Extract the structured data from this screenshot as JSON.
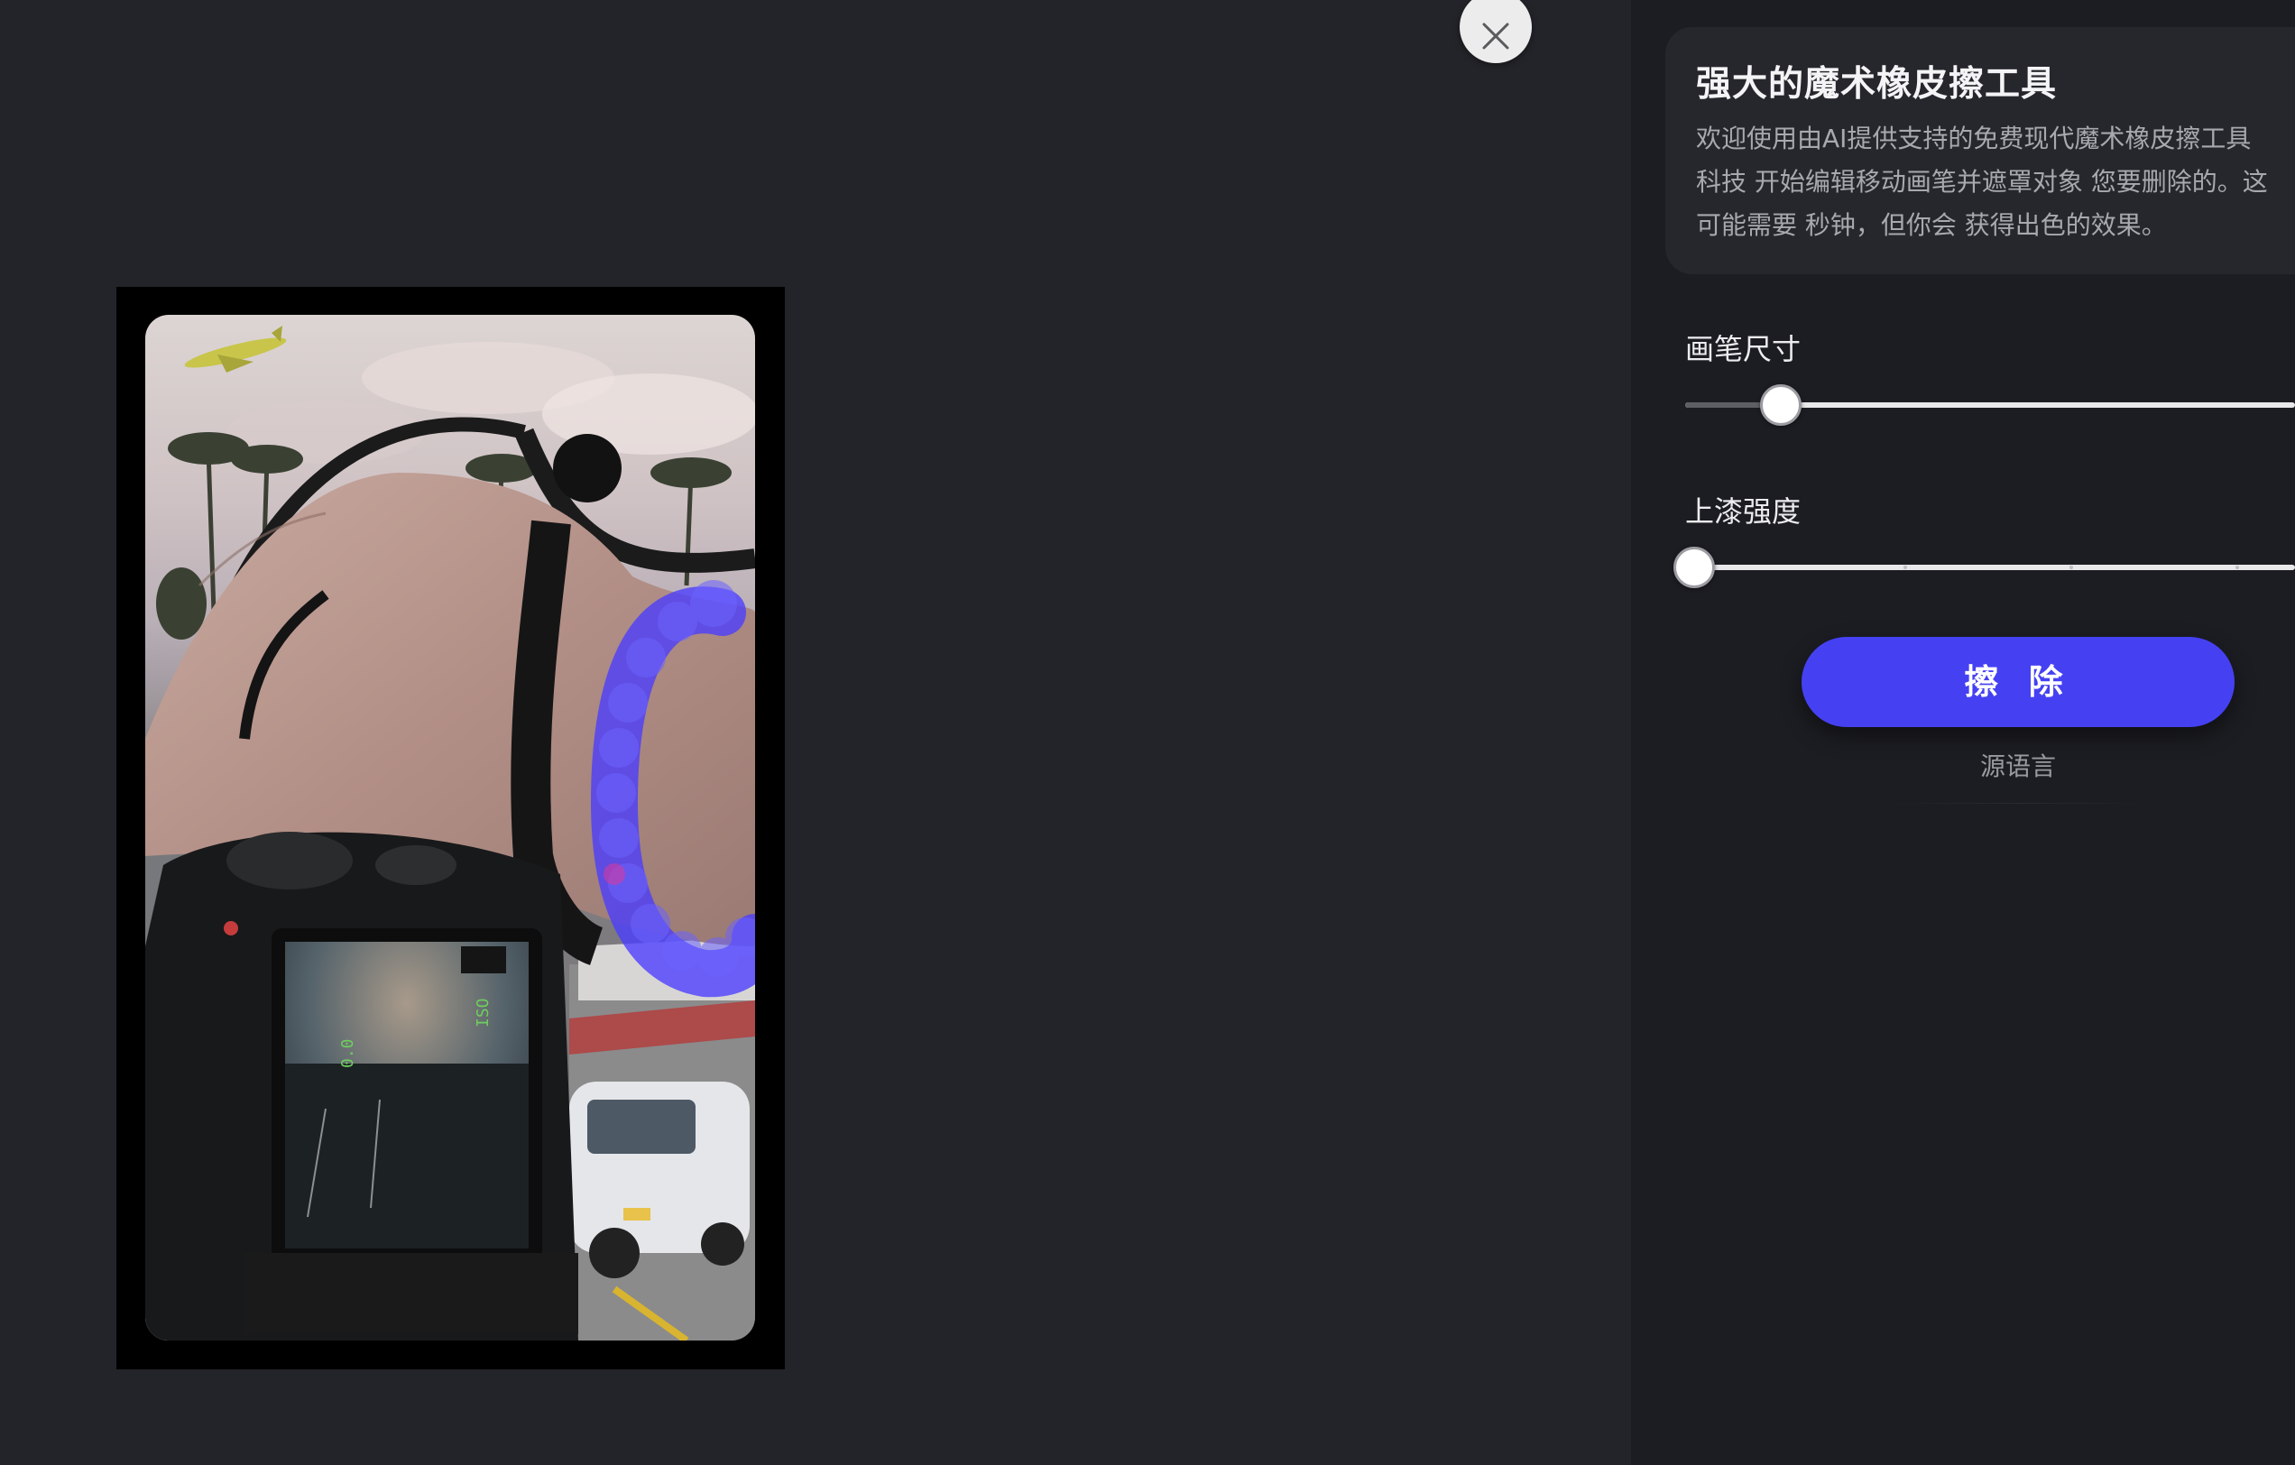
{
  "info": {
    "title": "强大的魔术橡皮擦工具",
    "description": "欢迎使用由AI提供支持的免费现代魔术橡皮擦工具 科技 开始编辑移动画笔并遮罩对象 您要删除的。这可能需要 秒钟，但你会 获得出色的效果。"
  },
  "controls": {
    "brush_size_label": "画笔尺寸",
    "brush_size_value": 0.15,
    "strength_label": "上漆强度",
    "strength_value": 0.0,
    "erase_button": "擦 除",
    "source_language": "源语言"
  },
  "colors": {
    "background": "#232429",
    "panel": "#1c1d22",
    "accent": "#4541f2",
    "mask": "#4a3cff"
  },
  "icons": {
    "close": "close-icon"
  }
}
